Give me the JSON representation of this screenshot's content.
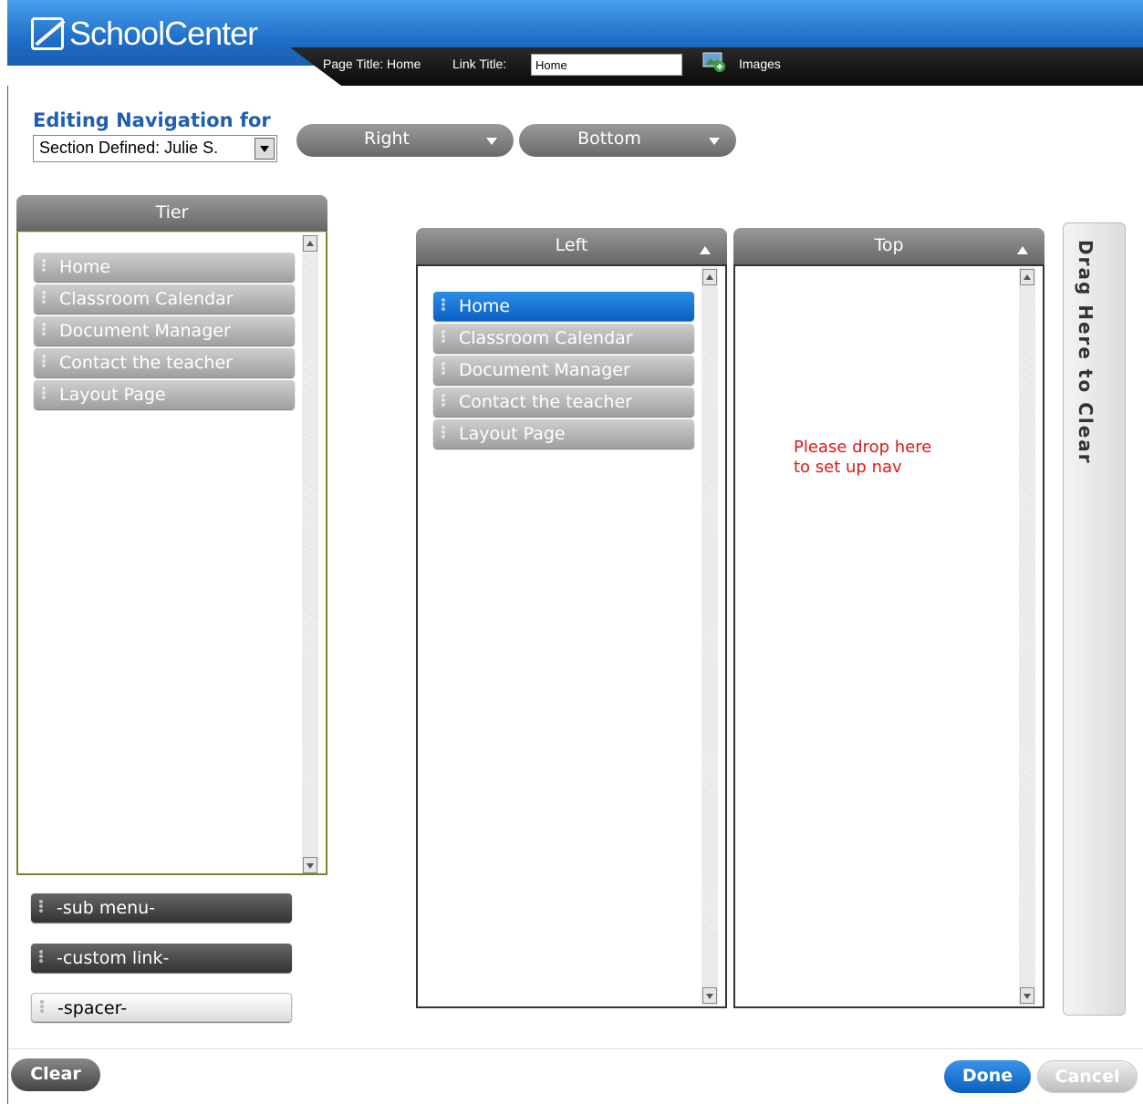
{
  "header": {
    "brand": "SchoolCenter",
    "page_title": "Page Title: Home",
    "link_title_label": "Link Title:",
    "link_title_value": "Home",
    "images_label": "Images"
  },
  "editing": {
    "label": "Editing Navigation for",
    "section_value": "Section Defined: Julie S."
  },
  "position_dropdowns": [
    "Right",
    "Bottom"
  ],
  "tier_panel": {
    "title": "Tier",
    "items": [
      "Home",
      "Classroom Calendar",
      "Document Manager",
      "Contact the teacher",
      "Layout Page"
    ]
  },
  "special_items": [
    "-sub menu-",
    "-custom link-",
    "-spacer-"
  ],
  "left_panel": {
    "title": "Left",
    "items": [
      "Home",
      "Classroom Calendar",
      "Document Manager",
      "Contact the teacher",
      "Layout Page"
    ],
    "selected": "Home"
  },
  "top_panel": {
    "title": "Top",
    "drop_message_line1": "Please drop here",
    "drop_message_line2": "to set up nav"
  },
  "clear_zone": "Drag Here to Clear",
  "buttons": {
    "clear": "Clear",
    "done": "Done",
    "cancel": "Cancel"
  },
  "colors": {
    "brand_blue": "#1f6ec8",
    "selected_item": "#0a60c4",
    "drop_message": "#e01818",
    "editing_label": "#1f5fb0"
  }
}
